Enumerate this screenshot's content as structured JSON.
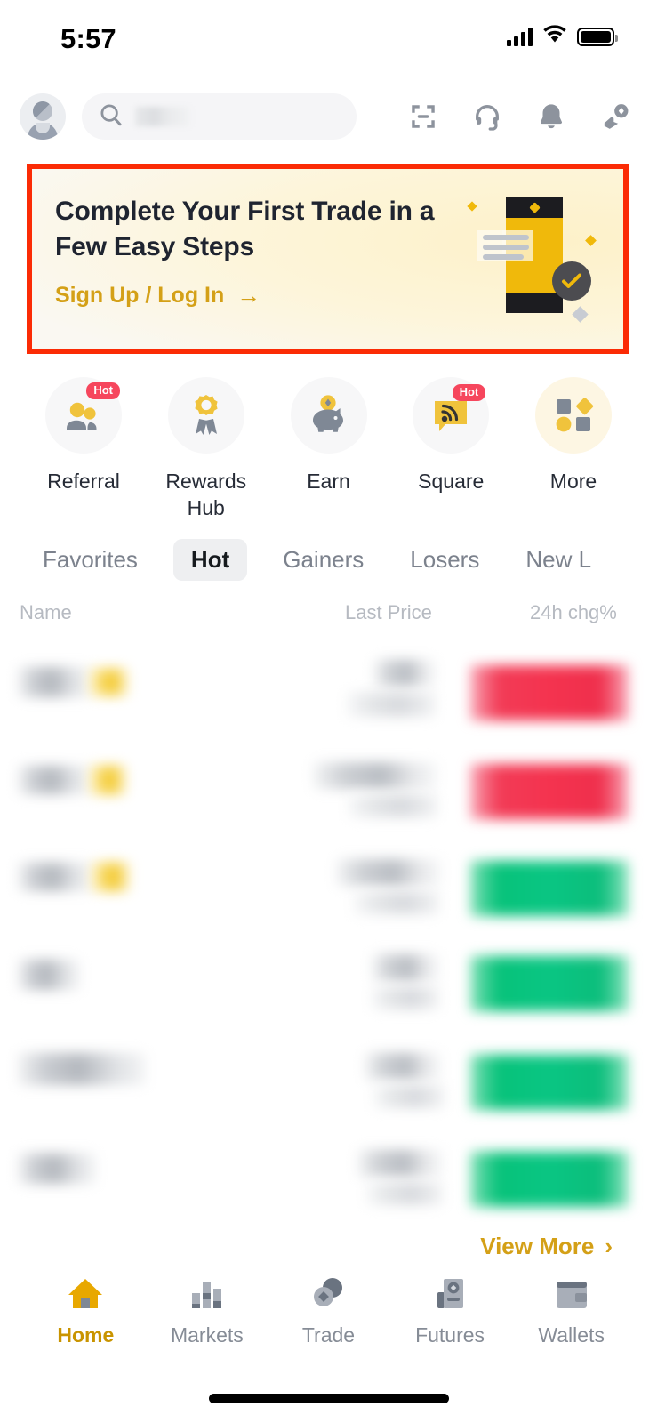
{
  "status_bar": {
    "time": "5:57",
    "icons": {
      "signal": "cellular-signal-icon",
      "wifi": "wifi-icon",
      "battery": "battery-icon"
    }
  },
  "header": {
    "avatar": "user-avatar",
    "search": {
      "placeholder": "",
      "value_redacted": true
    },
    "icons": [
      {
        "name": "scan-icon"
      },
      {
        "name": "headset-support-icon"
      },
      {
        "name": "bell-notification-icon"
      },
      {
        "name": "deposit-icon"
      }
    ]
  },
  "banner": {
    "title": "Complete Your First Trade in a Few Easy Steps",
    "cta": "Sign Up / Log In",
    "cta_arrow": "→",
    "highlight_color": "#FB2B05",
    "accent_color": "#F0B90B"
  },
  "quick_actions": [
    {
      "label": "Referral",
      "icon": "referral-people-icon",
      "badge": "Hot"
    },
    {
      "label": "Rewards Hub",
      "icon": "rewards-medal-icon",
      "badge": ""
    },
    {
      "label": "Earn",
      "icon": "earn-piggybank-icon",
      "badge": ""
    },
    {
      "label": "Square",
      "icon": "square-feed-icon",
      "badge": "Hot"
    },
    {
      "label": "More",
      "icon": "more-shapes-icon",
      "badge": ""
    }
  ],
  "market_tabs": [
    {
      "label": "Favorites",
      "active": false
    },
    {
      "label": "Hot",
      "active": true
    },
    {
      "label": "Gainers",
      "active": false
    },
    {
      "label": "Losers",
      "active": false
    },
    {
      "label": "New L",
      "active": false
    }
  ],
  "table": {
    "columns": {
      "name": "Name",
      "last_price": "Last Price",
      "change": "24h chg%"
    },
    "rows": [
      {
        "name_redacted": true,
        "has_tag": true,
        "price_redacted": true,
        "change_direction": "down"
      },
      {
        "name_redacted": true,
        "has_tag": true,
        "price_redacted": true,
        "change_direction": "down"
      },
      {
        "name_redacted": true,
        "has_tag": true,
        "price_redacted": true,
        "change_direction": "up"
      },
      {
        "name_redacted": true,
        "has_tag": false,
        "price_redacted": true,
        "change_direction": "up"
      },
      {
        "name_redacted": true,
        "has_tag": false,
        "price_redacted": true,
        "change_direction": "up"
      },
      {
        "name_redacted": true,
        "has_tag": false,
        "price_redacted": true,
        "change_direction": "up"
      }
    ]
  },
  "view_more": {
    "label": "View More",
    "chevron": "›"
  },
  "bottom_nav": [
    {
      "label": "Home",
      "icon": "home-icon",
      "active": true
    },
    {
      "label": "Markets",
      "icon": "markets-bars-icon",
      "active": false
    },
    {
      "label": "Trade",
      "icon": "trade-coins-icon",
      "active": false
    },
    {
      "label": "Futures",
      "icon": "futures-icon",
      "active": false
    },
    {
      "label": "Wallets",
      "icon": "wallet-icon",
      "active": false
    }
  ]
}
